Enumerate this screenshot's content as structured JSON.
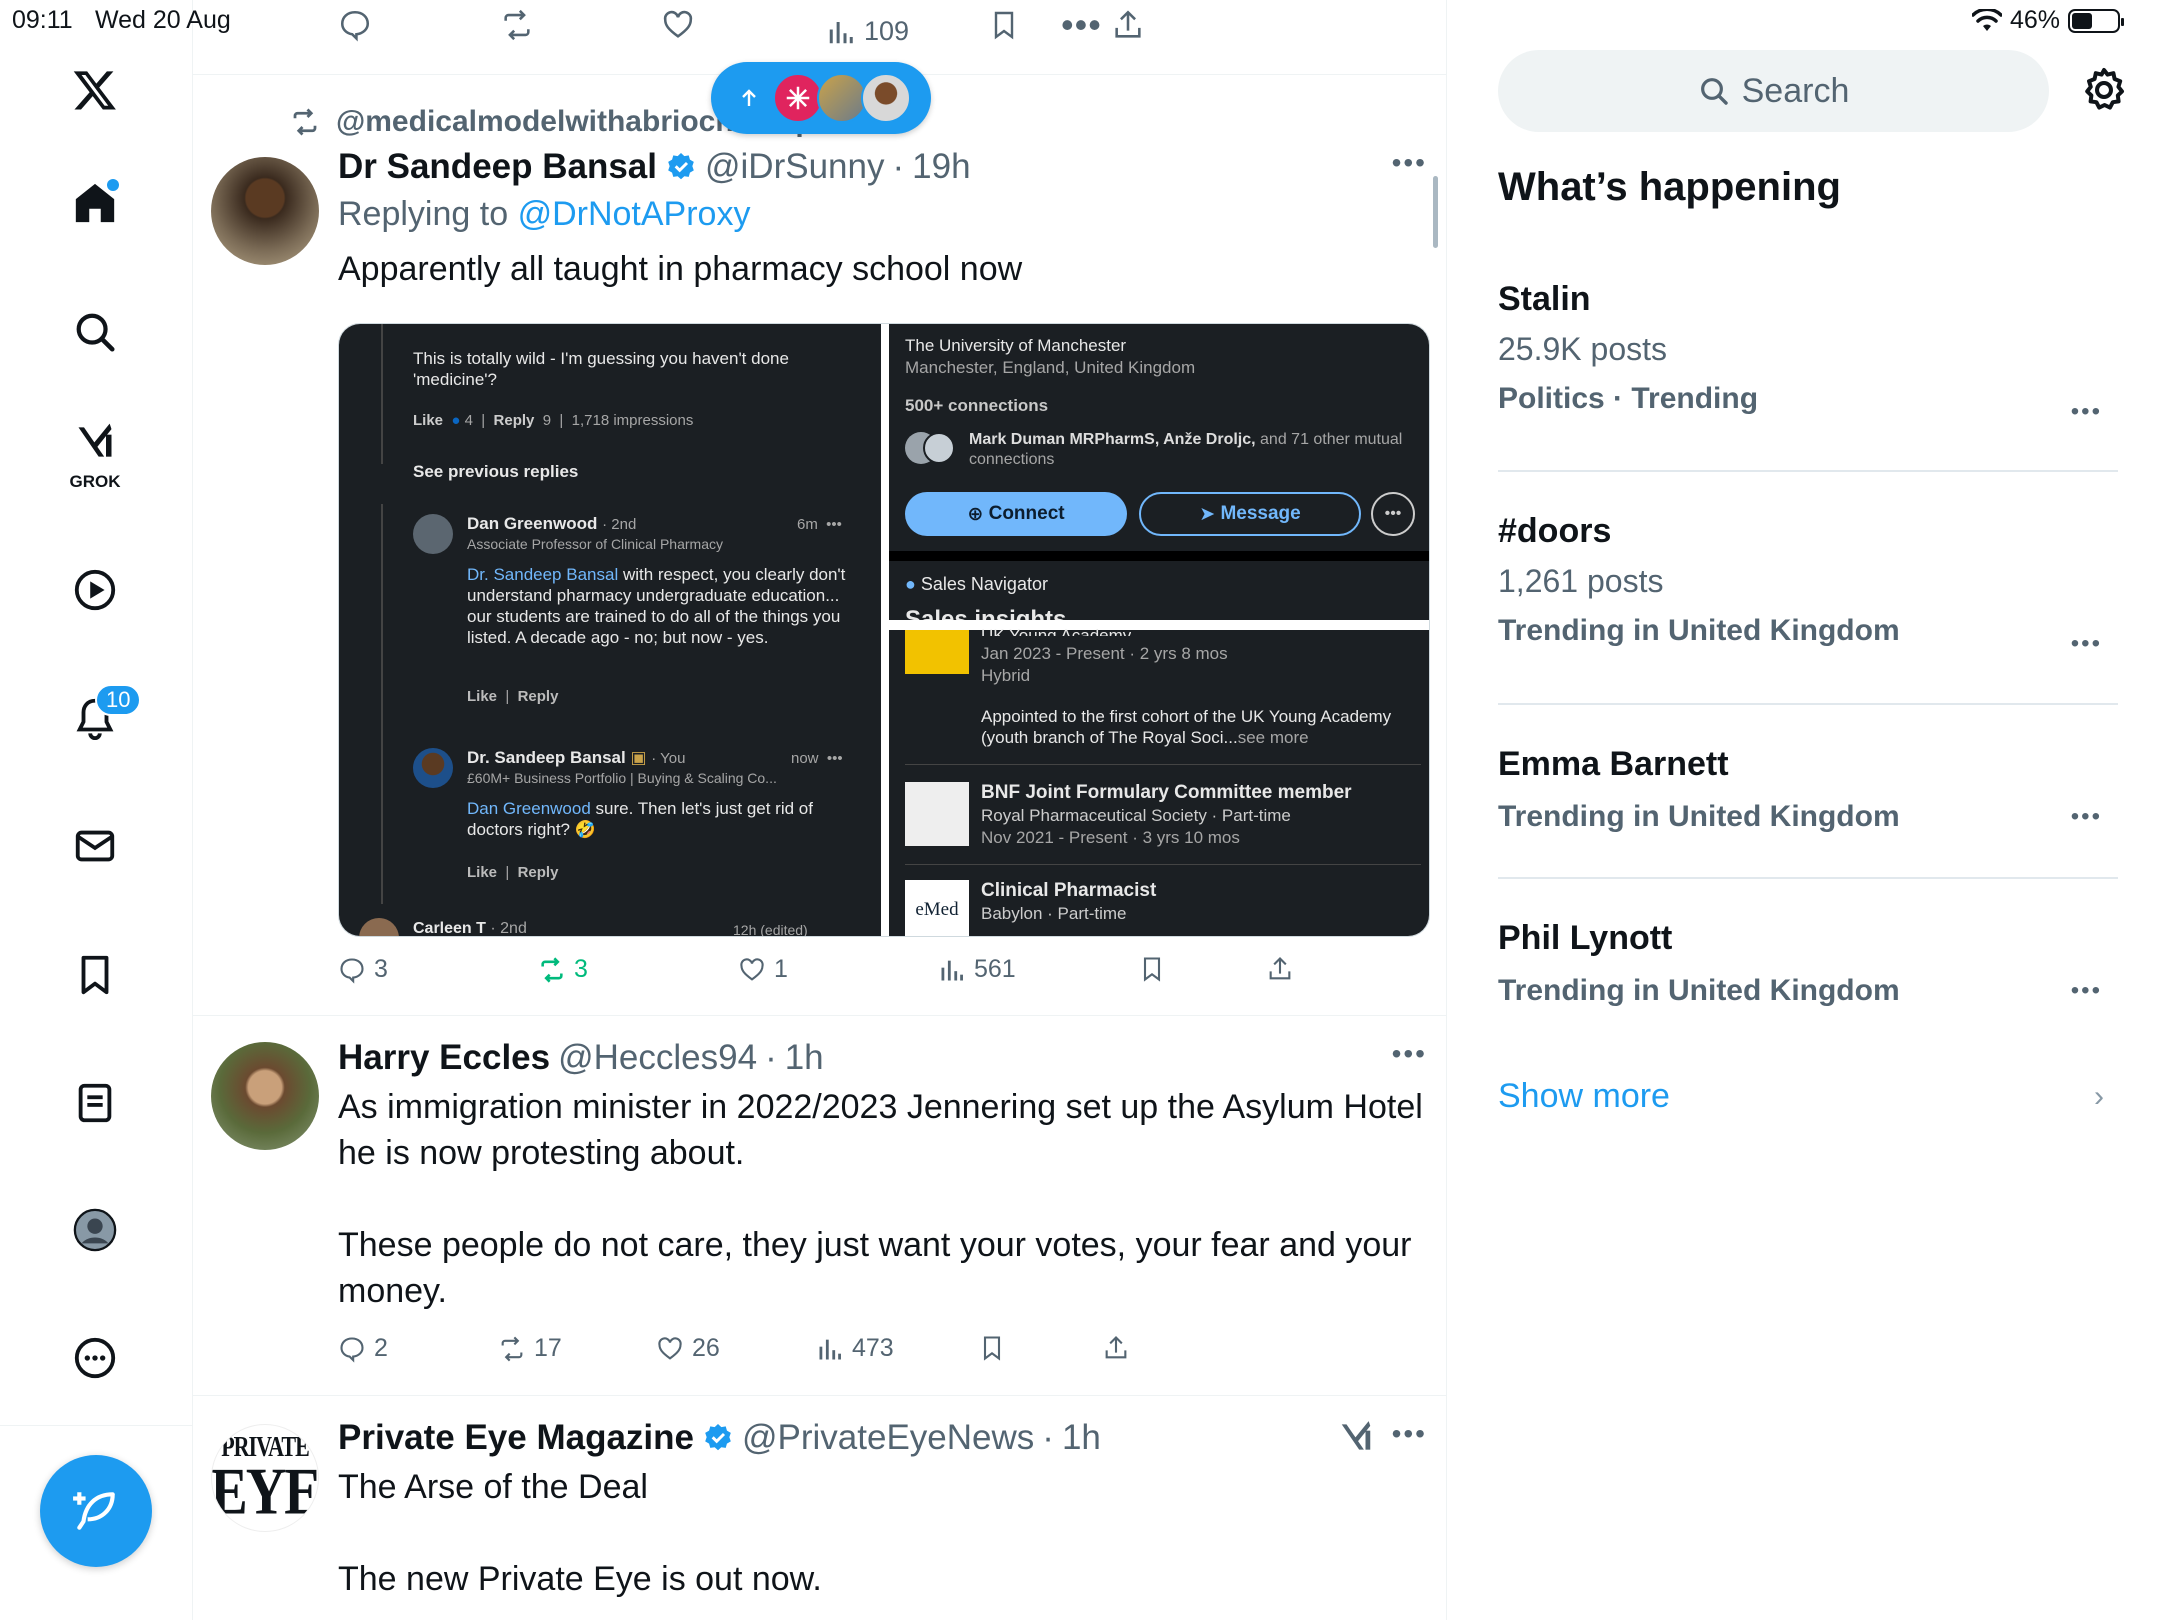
{
  "status_bar": {
    "time": "09:11",
    "date": "Wed 20 Aug",
    "battery": "46%"
  },
  "nav": {
    "grok_label": "GROK",
    "notification_count": "10"
  },
  "top_actions": {
    "views": "109"
  },
  "tweets": [
    {
      "repost_label": "@medicalmodelwithabrioch... reposted",
      "name": "Dr Sandeep Bansal",
      "handle": "@iDrSunny",
      "time": "19h",
      "replying_prefix": "Replying to",
      "replying_to": "@DrNotAProxy",
      "text": "Apparently all taught in pharmacy school now",
      "replies": "3",
      "reposts": "3",
      "likes": "1",
      "views": "561",
      "media": {
        "left": {
          "top_comment": "This is totally wild - I'm guessing you haven't done 'medicine'?",
          "like": "Like",
          "like_count": "4",
          "reply": "Reply",
          "reply_count": "9",
          "impressions": "1,718 impressions",
          "see_previous": "See previous replies",
          "c1_name": "Dan Greenwood",
          "c1_degree": "· 2nd",
          "c1_time": "6m",
          "c1_title": "Associate Professor of Clinical Pharmacy",
          "c1_mention": "Dr. Sandeep Bansal",
          "c1_text": " with respect, you clearly don't understand pharmacy undergraduate education... our students are trained to do all of the things you listed. A decade ago - no; but now - yes.",
          "c2_name": "Dr. Sandeep Bansal",
          "c2_degree": "· You",
          "c2_time": "now",
          "c2_title": "£60M+ Business Portfolio | Buying & Scaling Co...",
          "c2_mention": "Dan Greenwood",
          "c2_text": " sure. Then let's just get rid of doctors right? 🤣",
          "c3_name": "Carleen T",
          "c3_degree": "· 2nd",
          "c3_time": "12h (edited)"
        },
        "right": {
          "uni": "The University of Manchester",
          "location": "Manchester, England, United Kingdom",
          "connections": "500+ connections",
          "mutual_names": "Mark Duman MRPharmS, Anže Droljc,",
          "mutual_rest": " and 71 other mutual connections",
          "connect": "Connect",
          "message": "Message",
          "sales_nav": "Sales Navigator",
          "sales_insights": "Sales insights",
          "exp1_title": "UK Young Academy",
          "exp1_dates": "Jan 2023 - Present · 2 yrs 8 mos",
          "exp1_type": "Hybrid",
          "exp1_desc": "Appointed to the first cohort of the UK Young Academy (youth branch of The Royal Soci...",
          "exp1_more": "see more",
          "exp2_title": "BNF Joint Formulary Committee member",
          "exp2_org": "Royal Pharmaceutical Society · Part-time",
          "exp2_dates": "Nov 2021 - Present · 3 yrs 10 mos",
          "exp3_logo": "eMed",
          "exp3_title": "Clinical Pharmacist",
          "exp3_org": "Babylon · Part-time"
        }
      }
    },
    {
      "name": "Harry Eccles",
      "handle": "@Heccles94",
      "time": "1h",
      "text": "As immigration minister in 2022/2023 Jennering set up the Asylum Hotel he is now protesting about.\n\nThese people do not care, they just want your votes, your fear and your money.",
      "replies": "2",
      "reposts": "17",
      "likes": "26",
      "views": "473"
    },
    {
      "name": "Private Eye Magazine",
      "handle": "@PrivateEyeNews",
      "time": "1h",
      "avatar_text_1": "PRIVATE",
      "avatar_text_2": "EYE",
      "text": "The Arse of the Deal\n\nThe new Private Eye is out now."
    }
  ],
  "right": {
    "search_placeholder": "Search",
    "title": "What’s happening",
    "trends": [
      {
        "name": "Stalin",
        "count": "25.9K posts",
        "category": "Politics · Trending"
      },
      {
        "name": "#doors",
        "count": "1,261 posts",
        "category": "Trending in United Kingdom"
      },
      {
        "name": "Emma Barnett",
        "count": "",
        "category": "Trending in United Kingdom"
      },
      {
        "name": "Phil Lynott",
        "count": "",
        "category": "Trending in United Kingdom"
      }
    ],
    "show_more": "Show more"
  },
  "colors": {
    "accent": "#1d9bf0",
    "repost_green": "#00ba7c",
    "muted": "#536471"
  }
}
